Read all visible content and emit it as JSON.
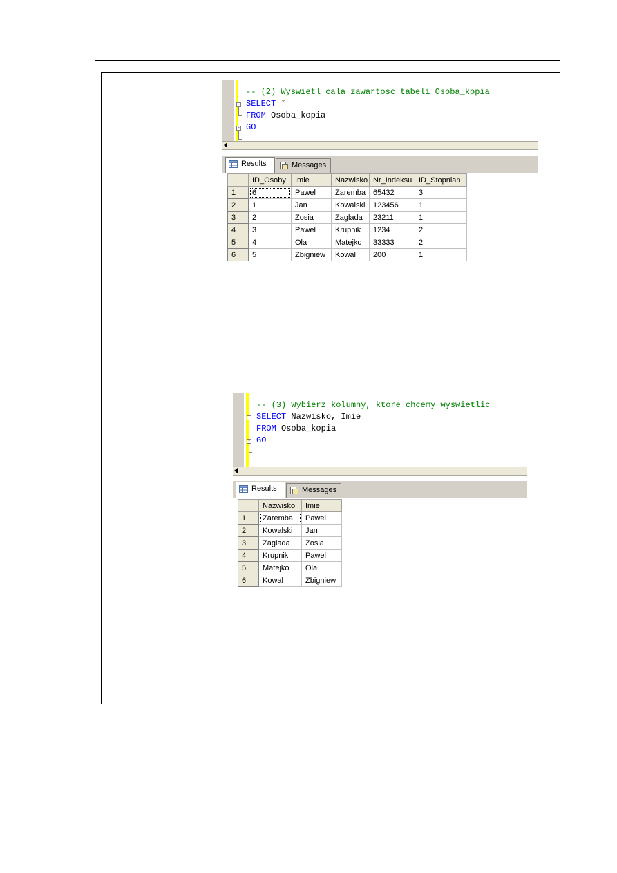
{
  "query1": {
    "lines": [
      {
        "comment": "-- (2) Wyswietl cala zawartosc tabeli Osoba_kopia"
      },
      {
        "keyword": "SELECT",
        "rest": " *"
      },
      {
        "keyword": "FROM",
        "rest": " Osoba_kopia"
      },
      {
        "keyword": "GO"
      }
    ],
    "tabs": {
      "results": "Results",
      "messages": "Messages"
    },
    "columns": [
      "ID_Osoby",
      "Imie",
      "Nazwisko",
      "Nr_Indeksu",
      "ID_Stopnian"
    ],
    "rows": [
      {
        "n": "1",
        "cells": [
          "6",
          "Pawel",
          "Zaremba",
          "65432",
          "3"
        ]
      },
      {
        "n": "2",
        "cells": [
          "1",
          "Jan",
          "Kowalski",
          "123456",
          "1"
        ]
      },
      {
        "n": "3",
        "cells": [
          "2",
          "Zosia",
          "Zaglada",
          "23211",
          "1"
        ]
      },
      {
        "n": "4",
        "cells": [
          "3",
          "Pawel",
          "Krupnik",
          "1234",
          "2"
        ]
      },
      {
        "n": "5",
        "cells": [
          "4",
          "Ola",
          "Matejko",
          "33333",
          "2"
        ]
      },
      {
        "n": "6",
        "cells": [
          "5",
          "Zbigniew",
          "Kowal",
          "200",
          "1"
        ]
      }
    ]
  },
  "query2": {
    "lines": [
      {
        "comment": "-- (3) Wybierz kolumny, ktore chcemy wyswietlic"
      },
      {
        "keyword": "SELECT",
        "rest": " Nazwisko, Imie"
      },
      {
        "keyword": "FROM",
        "rest": " Osoba_kopia"
      },
      {
        "keyword": "GO"
      }
    ],
    "tabs": {
      "results": "Results",
      "messages": "Messages"
    },
    "columns": [
      "Nazwisko",
      "Imie"
    ],
    "rows": [
      {
        "n": "1",
        "cells": [
          "Zaremba",
          "Pawel"
        ]
      },
      {
        "n": "2",
        "cells": [
          "Kowalski",
          "Jan"
        ]
      },
      {
        "n": "3",
        "cells": [
          "Zaglada",
          "Zosia"
        ]
      },
      {
        "n": "4",
        "cells": [
          "Krupnik",
          "Pawel"
        ]
      },
      {
        "n": "5",
        "cells": [
          "Matejko",
          "Ola"
        ]
      },
      {
        "n": "6",
        "cells": [
          "Kowal",
          "Zbigniew"
        ]
      }
    ]
  }
}
